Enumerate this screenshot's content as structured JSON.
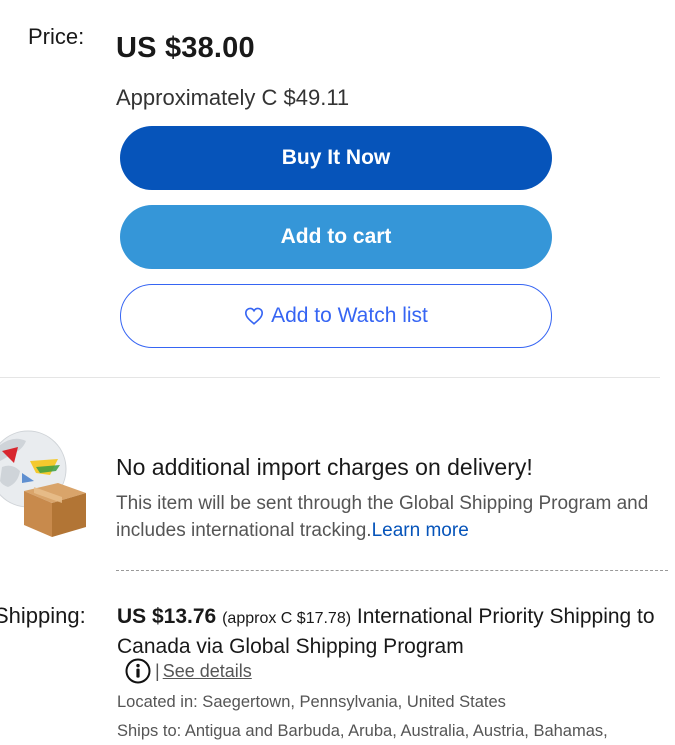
{
  "price": {
    "label": "Price:",
    "value": "US $38.00",
    "approx_prefix": "Approximately ",
    "approx_value": "C $49.11"
  },
  "buttons": {
    "buy_now": "Buy It Now",
    "add_to_cart": "Add to cart",
    "watch_list": "Add to Watch list"
  },
  "gsp": {
    "title": "No additional import charges on delivery!",
    "description": "This item will be sent through the Global Shipping Program and includes international tracking.",
    "learn_more": "Learn more"
  },
  "shipping": {
    "label": "Shipping:",
    "cost": "US $13.76",
    "approx": "(approx C $17.78)",
    "method": " International Priority Shipping to Canada via Global Shipping Program",
    "separator": "|",
    "see_details": "See details",
    "located_in": "Located in: Saegertown, Pennsylvania, United States",
    "ships_to": "Ships to: Antigua and Barbuda, Aruba, Australia, Austria, Bahamas,"
  },
  "icons": {
    "heart": "heart-outline-icon",
    "info": "info-icon",
    "gsp": "globe-box-icon"
  },
  "colors": {
    "buy_now_bg": "#0654ba",
    "add_to_cart_bg": "#3596d8",
    "watch_border": "#3665f3",
    "link": "#0654ba"
  }
}
